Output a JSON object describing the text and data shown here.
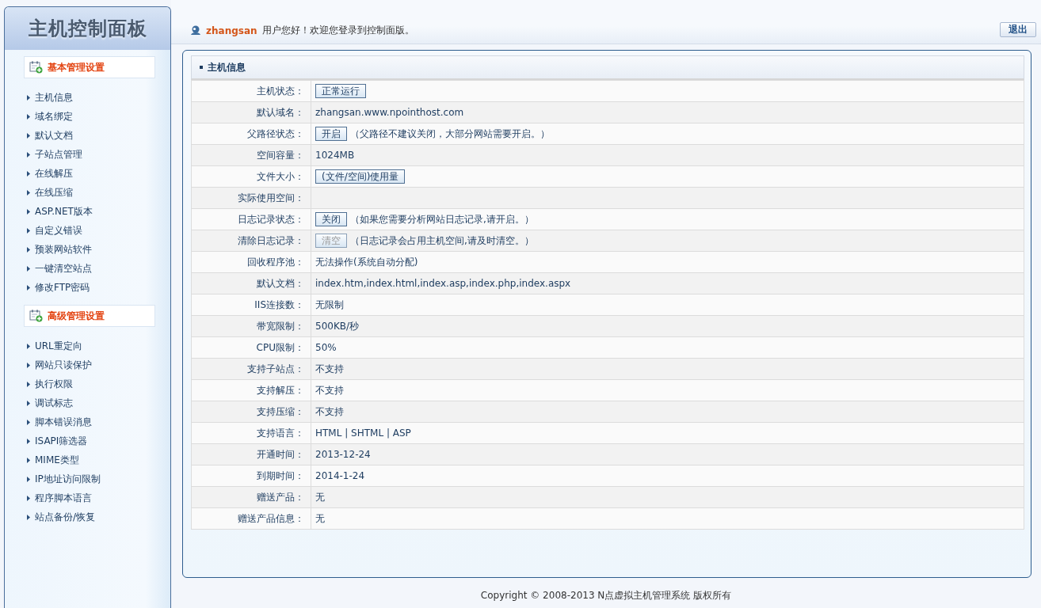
{
  "logo": "主机控制面板",
  "sidebar": {
    "sections": [
      {
        "title": "基本管理设置",
        "items": [
          "主机信息",
          "域名绑定",
          "默认文档",
          "子站点管理",
          "在线解压",
          "在线压缩",
          "ASP.NET版本",
          "自定义错误",
          "预装网站软件",
          "一键清空站点",
          "修改FTP密码"
        ]
      },
      {
        "title": "高级管理设置",
        "items": [
          "URL重定向",
          "网站只读保护",
          "执行权限",
          "调试标志",
          "脚本错误消息",
          "ISAPI筛选器",
          "MIME类型",
          "IP地址访问限制",
          "程序脚本语言",
          "站点备份/恢复"
        ]
      }
    ]
  },
  "header": {
    "username": "zhangsan",
    "greeting": "用户您好！欢迎您登录到控制面版。",
    "logout": "退出"
  },
  "panel": {
    "title": "主机信息",
    "rows": [
      {
        "label": "主机状态：",
        "kind": "button",
        "button": "正常运行",
        "disabled": false
      },
      {
        "label": "默认域名：",
        "kind": "text",
        "value": "zhangsan.www.npointhost.com"
      },
      {
        "label": "父路径状态：",
        "kind": "button",
        "button": "开启",
        "disabled": false,
        "note": "（父路径不建议关闭，大部分网站需要开启。）"
      },
      {
        "label": "空间容量：",
        "kind": "text",
        "value": "1024MB"
      },
      {
        "label": "文件大小：",
        "kind": "button",
        "button": "(文件/空间)使用量",
        "disabled": false
      },
      {
        "label": "实际使用空间：",
        "kind": "text"
      },
      {
        "label": "日志记录状态：",
        "kind": "button",
        "button": "关闭",
        "disabled": false,
        "note": "（如果您需要分析网站日志记录,请开启。）"
      },
      {
        "label": "清除日志记录：",
        "kind": "button",
        "button": "清空",
        "disabled": true,
        "note": "（日志记录会占用主机空间,请及时清空。）"
      },
      {
        "label": "回收程序池：",
        "kind": "text",
        "value": "无法操作(系统自动分配)"
      },
      {
        "label": "默认文档：",
        "kind": "text",
        "value": "index.htm,index.html,index.asp,index.php,index.aspx"
      },
      {
        "label": "IIS连接数：",
        "kind": "text",
        "value": "无限制"
      },
      {
        "label": "带宽限制：",
        "kind": "text",
        "value": "500KB/秒"
      },
      {
        "label": "CPU限制：",
        "kind": "text",
        "value": "50%"
      },
      {
        "label": "支持子站点：",
        "kind": "text",
        "value": "不支持"
      },
      {
        "label": "支持解压：",
        "kind": "text",
        "value": "不支持"
      },
      {
        "label": "支持压缩：",
        "kind": "text",
        "value": "不支持"
      },
      {
        "label": "支持语言：",
        "kind": "text",
        "value": "HTML | SHTML | ASP"
      },
      {
        "label": "开通时间：",
        "kind": "text",
        "value": "2013-12-24"
      },
      {
        "label": "到期时间：",
        "kind": "text",
        "value": "2014-1-24"
      },
      {
        "label": "赠送产品：",
        "kind": "text",
        "value": "无"
      },
      {
        "label": "赠送产品信息：",
        "kind": "text",
        "value": "无"
      }
    ]
  },
  "footer": "Copyright © 2008-2013 N点虚拟主机管理系统 版权所有"
}
